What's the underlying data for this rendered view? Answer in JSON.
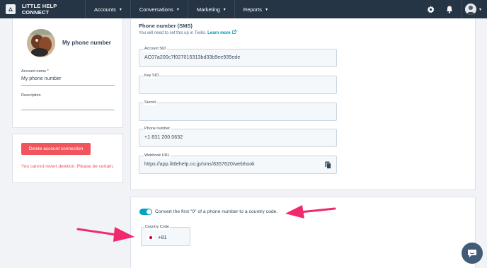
{
  "nav": {
    "brand": "LITTLE HELP CONNECT",
    "menu": [
      {
        "label": "Accounts",
        "chevron": "▾"
      },
      {
        "label": "Conversations",
        "chevron": "▾"
      },
      {
        "label": "Marketing",
        "chevron": "▾"
      },
      {
        "label": "Reports",
        "chevron": "▾"
      }
    ],
    "icons": [
      "gear-icon",
      "bell-icon",
      "user-avatar"
    ],
    "avatar_chevron": "▾"
  },
  "profile": {
    "name": "My phone number",
    "account_name_label": "Account name *",
    "account_name_value": "My phone number",
    "description_label": "Description",
    "description_value": ""
  },
  "danger": {
    "delete_button": "Delete account connection",
    "warning": "You cannot revert deletion. Please be certain."
  },
  "sms": {
    "title": "Phone number (SMS)",
    "subtitle": "You will need to set this up in Twilio.",
    "learn_more": "Learn more",
    "fields": {
      "account_sid": {
        "label": "Account SID",
        "value": "AC07a200c7f027015313bd33b9ee935ede"
      },
      "key_sid": {
        "label": "Key SID",
        "value": ""
      },
      "secret": {
        "label": "Secret",
        "value": ""
      },
      "phone_number": {
        "label": "Phone number",
        "value": "+1 831 200 0632"
      },
      "webhook_url": {
        "label": "Webhook URL",
        "value": "https://app.littlehelp.co.jp/sms/8357620/webhook"
      }
    }
  },
  "country": {
    "toggle_on": true,
    "toggle_label": "Convert the first \"0\" of a phone number to a country code.",
    "country_code_label": "Country Code",
    "country_code_value": "+81",
    "flag": "japan-flag"
  },
  "colors": {
    "nav_bg": "#263545",
    "accent": "#00a4bd",
    "danger": "#f2545b",
    "annotation_arrow": "#f0286e",
    "link": "#0091ae"
  }
}
